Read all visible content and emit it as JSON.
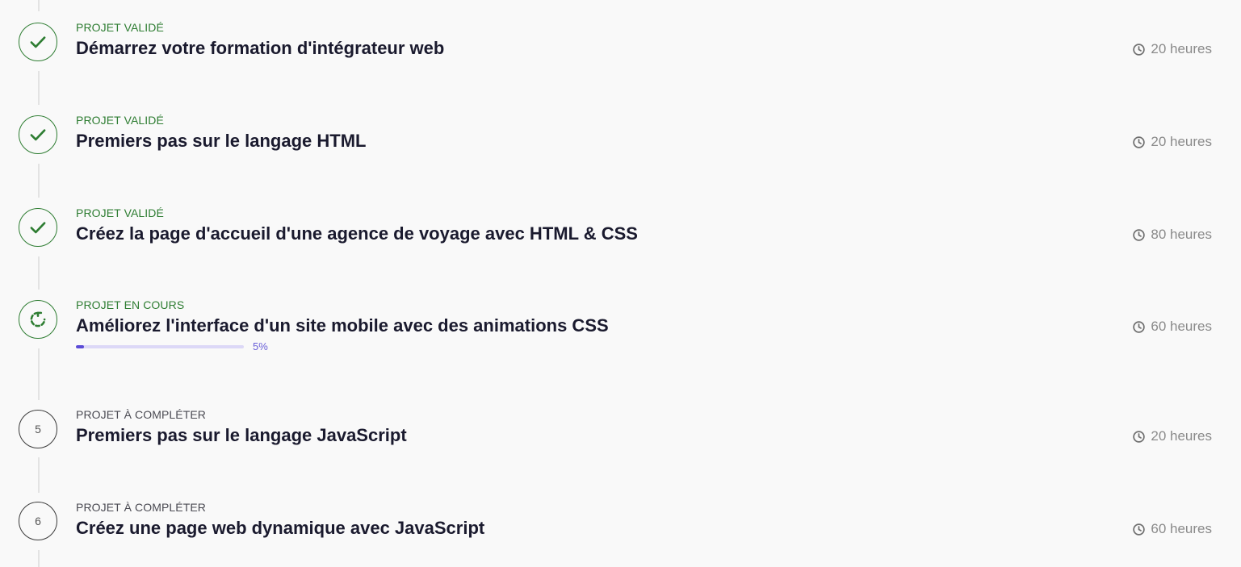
{
  "projects": [
    {
      "status": "PROJET VALIDÉ",
      "title": "Démarrez votre formation d'intégrateur web",
      "duration": "20 heures",
      "state": "done",
      "icon": "check-icon"
    },
    {
      "status": "PROJET VALIDÉ",
      "title": "Premiers pas sur le langage HTML",
      "duration": "20 heures",
      "state": "done",
      "icon": "check-icon"
    },
    {
      "status": "PROJET VALIDÉ",
      "title": "Créez la page d'accueil d'une agence de voyage avec HTML & CSS",
      "duration": "80 heures",
      "state": "done",
      "icon": "check-icon"
    },
    {
      "status": "PROJET EN COURS",
      "title": "Améliorez l'interface d'un site mobile avec des animations CSS",
      "duration": "60 heures",
      "state": "in-progress",
      "icon": "refresh-icon",
      "progress": 0.05,
      "progress_label": "5%"
    },
    {
      "status": "PROJET À COMPLÉTER",
      "title": "Premiers pas sur le langage JavaScript",
      "duration": "20 heures",
      "state": "todo",
      "number": "5"
    },
    {
      "status": "PROJET À COMPLÉTER",
      "title": "Créez une page web dynamique avec JavaScript",
      "duration": "60 heures",
      "state": "todo",
      "number": "6"
    }
  ],
  "colors": {
    "validated": "#2e7d32",
    "todo_status": "#4a4a52",
    "title": "#1a1a2e",
    "duration": "#8a8a8a",
    "progress_fill": "#5b4bd6",
    "progress_track": "#dcd8f7"
  }
}
